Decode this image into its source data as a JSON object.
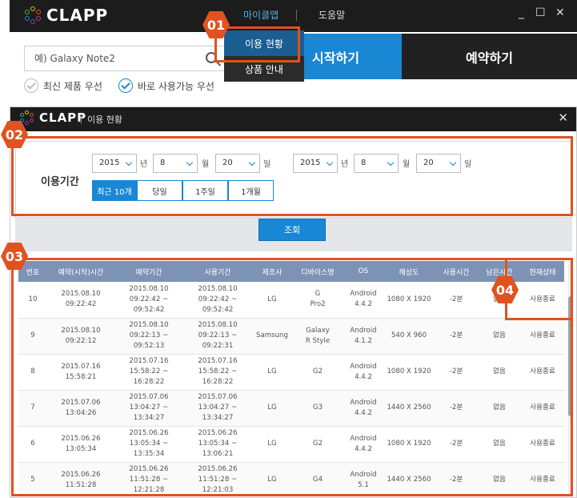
{
  "app": {
    "logo_text": "CLAPP"
  },
  "top_window": {
    "menu": {
      "my_clapp": "마이클앱",
      "help": "도움말"
    },
    "window_controls": {
      "minimize": "_",
      "maximize": "☐",
      "close": "✕"
    },
    "search": {
      "placeholder": "예) Galaxy Note2"
    },
    "options": {
      "latest": "최신 제품 우선",
      "available": "바로 사용가능 우선"
    },
    "start_label": "시작하기",
    "reserve_label": "예약하기",
    "dropdown": {
      "usage": "이용 현황",
      "product_info": "상품 안내"
    }
  },
  "usage_window": {
    "title": "이용 현황",
    "close": "✕",
    "filter": {
      "label": "이용기간",
      "from": {
        "year": "2015",
        "month": "8",
        "day": "20"
      },
      "to": {
        "year": "2015",
        "month": "8",
        "day": "20"
      },
      "units": {
        "year": "년",
        "month": "월",
        "day": "일"
      },
      "quick": [
        "최근 10개",
        "당일",
        "1주일",
        "1개월"
      ]
    },
    "lookup_label": "조회",
    "table": {
      "headers": [
        "번호",
        "예약(시작)시간",
        "예약기간",
        "사용기간",
        "제조사",
        "디바이스명",
        "OS",
        "해상도",
        "사용시간",
        "남은시간",
        "현재상태"
      ],
      "rows": [
        {
          "no": "10",
          "start": [
            "2015.08.10",
            "09:22:42"
          ],
          "reserve": [
            "2015.08.10",
            "09:22:42 ~ 09:52:42"
          ],
          "use": [
            "2015.08.10",
            "09:22:42 ~ 09:52:42"
          ],
          "maker": "LG",
          "device": [
            "G",
            "Pro2"
          ],
          "os": [
            "Android",
            "4.4.2"
          ],
          "res": "1080 X 1920",
          "usetime": "-2분",
          "remain": "없음",
          "status": "사용종료"
        },
        {
          "no": "9",
          "start": [
            "2015.08.10",
            "09:22:12"
          ],
          "reserve": [
            "2015.08.10",
            "09:22:13 ~ 09:52:13"
          ],
          "use": [
            "2015.08.10",
            "09:22:13 ~ 09:22:31"
          ],
          "maker": "Samsung",
          "device": [
            "Galaxy",
            "R Style"
          ],
          "os": [
            "Android",
            "4.1.2"
          ],
          "res": "540 X 960",
          "usetime": "-2분",
          "remain": "없음",
          "status": "사용종료"
        },
        {
          "no": "8",
          "start": [
            "2015.07.16",
            "15:58:21"
          ],
          "reserve": [
            "2015.07.16",
            "15:58:22 ~ 16:28:22"
          ],
          "use": [
            "2015.07.16",
            "15:58:22 ~ 16:28:22"
          ],
          "maker": "LG",
          "device": [
            "G2",
            ""
          ],
          "os": [
            "Android",
            "4.4.2"
          ],
          "res": "1080 X 1920",
          "usetime": "-2분",
          "remain": "없음",
          "status": "사용종료"
        },
        {
          "no": "7",
          "start": [
            "2015.07.06",
            "13:04:26"
          ],
          "reserve": [
            "2015.07.06",
            "13:04:27 ~ 13:34:27"
          ],
          "use": [
            "2015.07.06",
            "13:04:27 ~ 13:34:27"
          ],
          "maker": "LG",
          "device": [
            "G3",
            ""
          ],
          "os": [
            "Android",
            "4.4.2"
          ],
          "res": "1440 X 2560",
          "usetime": "-2분",
          "remain": "없음",
          "status": "사용종료"
        },
        {
          "no": "6",
          "start": [
            "2015.06.26",
            "13:05:34"
          ],
          "reserve": [
            "2015.06.26",
            "13:05:34 ~ 13:35:34"
          ],
          "use": [
            "2015.06.26",
            "13:05:34 ~ 13:06:21"
          ],
          "maker": "LG",
          "device": [
            "G2",
            ""
          ],
          "os": [
            "Android",
            "4.4.2"
          ],
          "res": "1080 X 1920",
          "usetime": "-2분",
          "remain": "없음",
          "status": "사용종료"
        },
        {
          "no": "5",
          "start": [
            "2015.06.26",
            "11:51:28"
          ],
          "reserve": [
            "2015.06.26",
            "11:51:28 ~ 12:21:28"
          ],
          "use": [
            "2015.06.26",
            "11:51:28 ~ 12:21:03"
          ],
          "maker": "LG",
          "device": [
            "G4",
            ""
          ],
          "os": [
            "Android",
            "5.1"
          ],
          "res": "1440 X 2560",
          "usetime": "-2분",
          "remain": "없음",
          "status": "사용종료"
        }
      ]
    }
  },
  "callouts": [
    "01",
    "02",
    "03",
    "04"
  ],
  "colors": {
    "accent": "#1a87d4",
    "callout": "#e0521f",
    "header": "#7d93b6",
    "dark": "#1c1c1c"
  }
}
